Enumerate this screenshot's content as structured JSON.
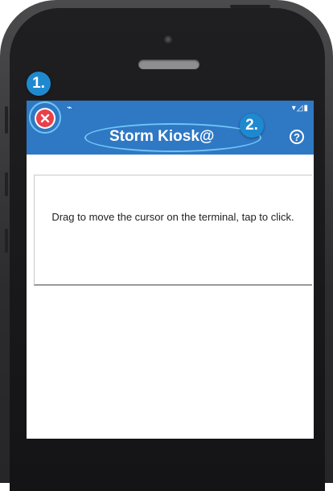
{
  "app_bar": {
    "title": "Storm Kiosk@",
    "close_symbol": "✕",
    "help_symbol": "?",
    "status_left": "⌁",
    "status_right": "▾◿▮",
    "color": "#2f78c4"
  },
  "annotations": {
    "callout_1": "1.",
    "callout_2": "2.",
    "callout_color": "#1f89cf",
    "ring_color": "#6fc6f5"
  },
  "touchpad": {
    "instruction": "Drag to move the cursor on the terminal, tap to click."
  },
  "icons": {
    "close": "close-icon",
    "help": "help-icon"
  }
}
